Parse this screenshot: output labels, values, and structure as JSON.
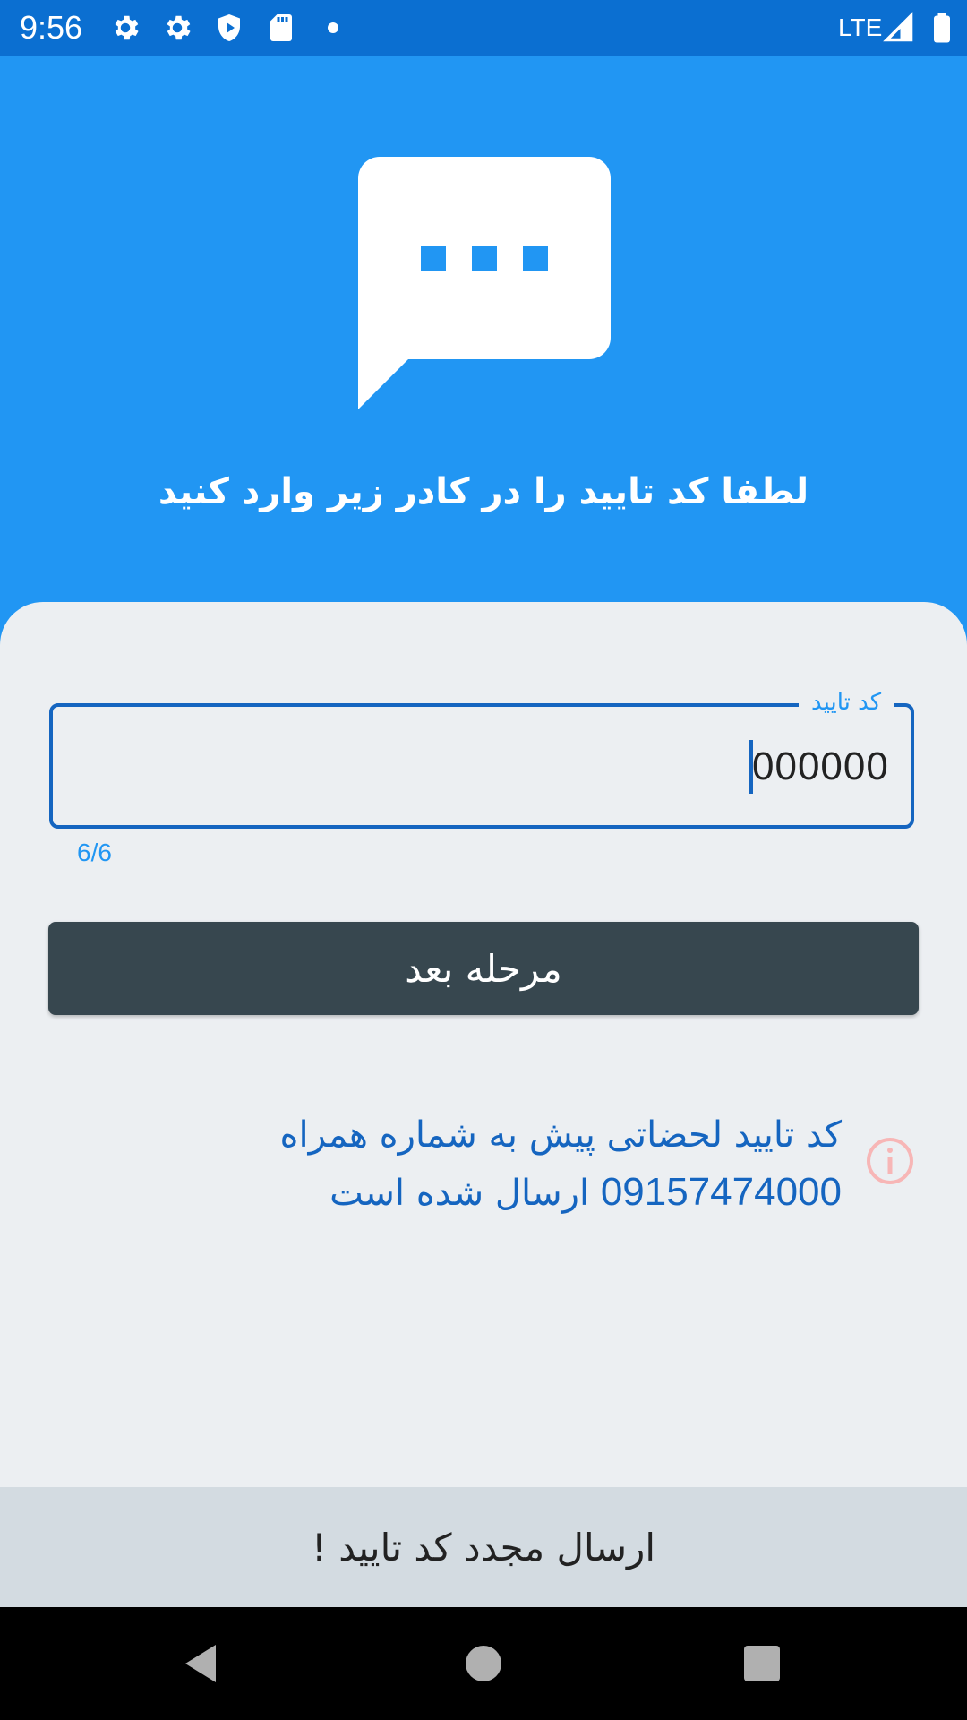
{
  "status_bar": {
    "time": "9:56",
    "network": "LTE",
    "icons": [
      "gear-icon",
      "gear-icon",
      "shield-play-icon",
      "sd-card-icon",
      "dot-icon",
      "signal-icon",
      "battery-icon"
    ]
  },
  "hero": {
    "icon": "message-bubble-icon",
    "title": "لطفا کد تایید را در کادر زیر وارد کنید"
  },
  "form": {
    "code_label": "کد تایید",
    "code_value": "000000",
    "char_counter": "6/6"
  },
  "next_button": {
    "label": "مرحله بعد"
  },
  "info": {
    "icon": "info-icon",
    "line1": "کد تایید لحضاتی پیش به شماره همراه",
    "line2_number": "09157474000",
    "line2_rest": "ارسال شده است"
  },
  "resend": {
    "label": "ارسال مجدد کد تایید !"
  },
  "nav": {
    "icons": [
      "back-icon",
      "home-icon",
      "recents-icon"
    ]
  },
  "colors": {
    "primary": "#2196f3",
    "status_bar": "#0b6fd1",
    "button": "#37474f",
    "info_text": "#1565c0",
    "info_icon": "#f7b6b6",
    "card": "#eceff2",
    "resend_bar": "#d3dbe1"
  }
}
